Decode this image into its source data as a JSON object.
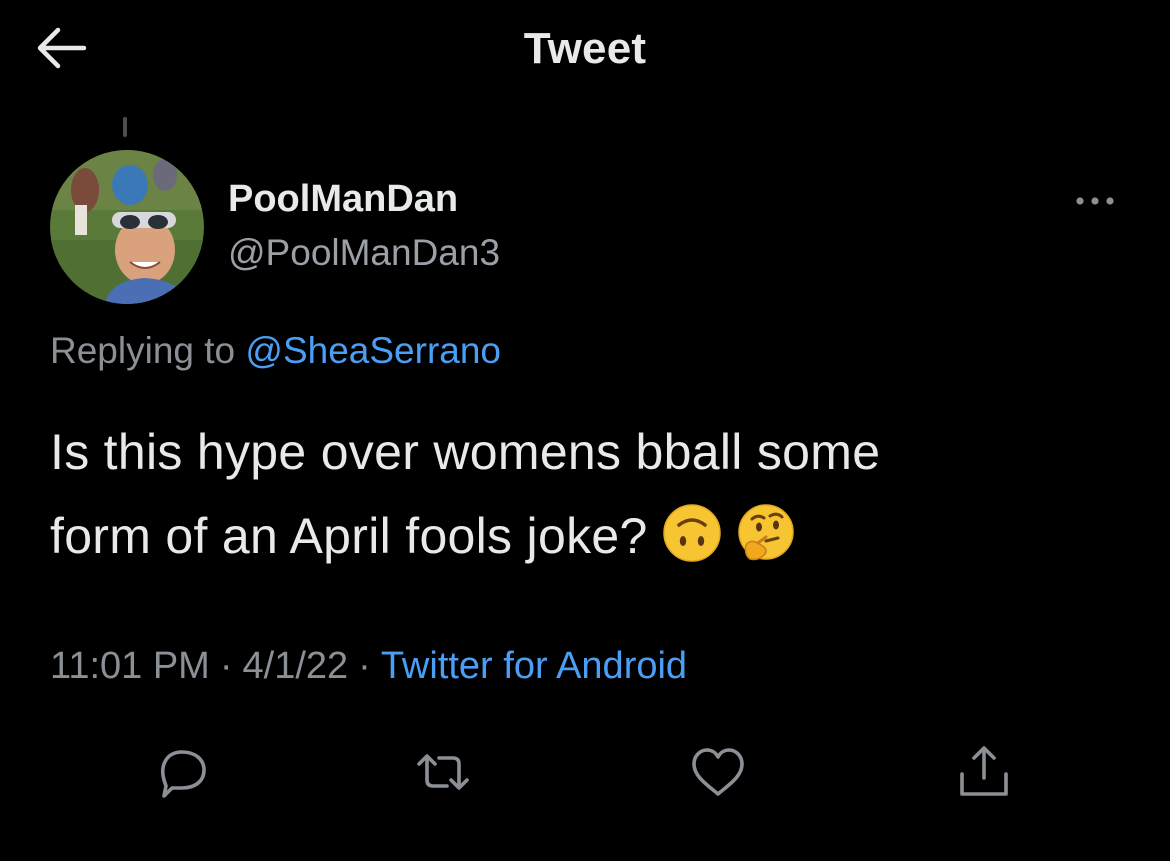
{
  "header": {
    "title": "Tweet",
    "back_icon": "arrow-left-icon"
  },
  "tweet": {
    "author": {
      "display_name": "PoolManDan",
      "handle": "@PoolManDan3",
      "avatar_icon": "avatar-photo"
    },
    "more_icon": "more-horizontal-icon",
    "replying_prefix": "Replying to",
    "replying_to": "@SheaSerrano",
    "text_line1": "Is this hype over womens bball some",
    "text_line2": "form of an April fools joke?",
    "emojis": [
      "upside-down-face",
      "thinking-face"
    ],
    "time": "11:01 PM",
    "date": "4/1/22",
    "separator": "·",
    "source": "Twitter for Android"
  },
  "actions": {
    "reply_icon": "reply-icon",
    "retweet_icon": "retweet-icon",
    "like_icon": "heart-icon",
    "share_icon": "share-icon"
  },
  "colors": {
    "background": "#000000",
    "text_primary": "#e7e9ea",
    "text_secondary": "#8b9096",
    "link": "#4a9ff5",
    "emoji_yellow": "#f7c531"
  }
}
